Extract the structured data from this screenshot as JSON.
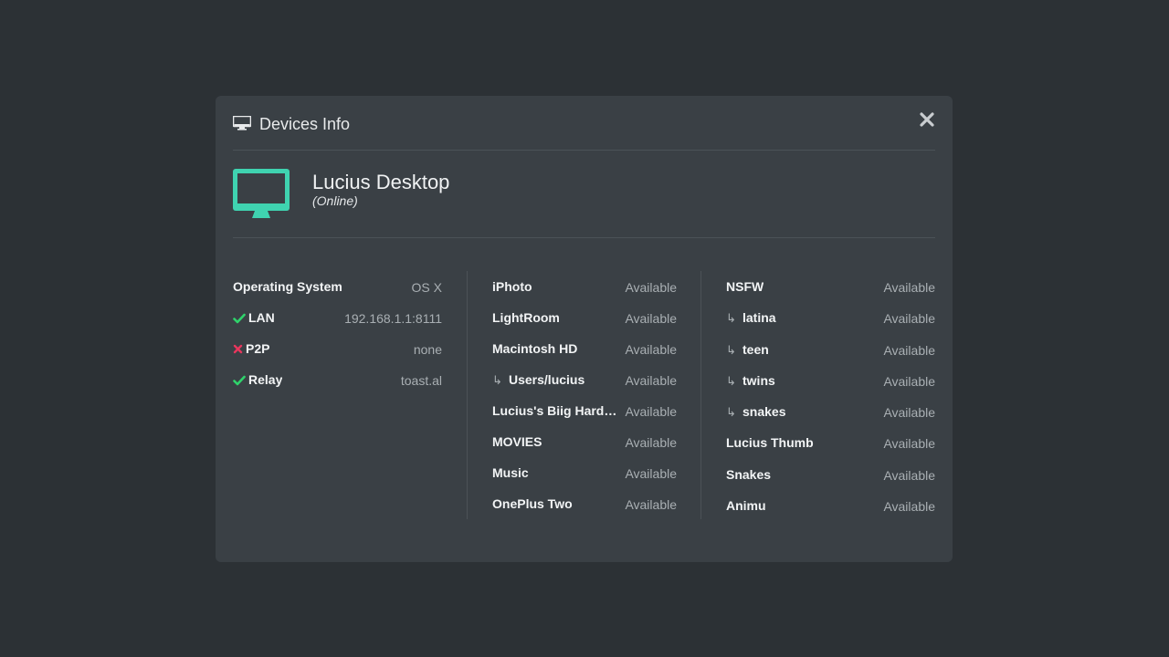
{
  "modal": {
    "title": "Devices Info"
  },
  "device": {
    "name": "Lucius Desktop",
    "status": "(Online)"
  },
  "colors": {
    "accent": "#3fd3b0",
    "ok": "#2fd36b",
    "error": "#e8365d"
  },
  "system": [
    {
      "label": "Operating System",
      "value": "OS X",
      "icon": ""
    },
    {
      "label": "LAN",
      "value": "192.168.1.1:8111",
      "icon": "check-icon"
    },
    {
      "label": "P2P",
      "value": "none",
      "icon": "cross-icon"
    },
    {
      "label": "Relay",
      "value": "toast.al",
      "icon": "check-icon"
    }
  ],
  "folders_left": [
    {
      "label": "iPhoto",
      "value": "Available",
      "sub": false
    },
    {
      "label": "LightRoom",
      "value": "Available",
      "sub": false
    },
    {
      "label": "Macintosh HD",
      "value": "Available",
      "sub": false
    },
    {
      "label": "Users/lucius",
      "value": "Available",
      "sub": true
    },
    {
      "label": "Lucius's Biig Hard…",
      "value": "Available",
      "sub": false
    },
    {
      "label": "MOVIES",
      "value": "Available",
      "sub": false
    },
    {
      "label": "Music",
      "value": "Available",
      "sub": false
    },
    {
      "label": "OnePlus Two",
      "value": "Available",
      "sub": false
    }
  ],
  "folders_right": [
    {
      "label": "NSFW",
      "value": "Available",
      "sub": false
    },
    {
      "label": "latina",
      "value": "Available",
      "sub": true
    },
    {
      "label": "teen",
      "value": "Available",
      "sub": true
    },
    {
      "label": "twins",
      "value": "Available",
      "sub": true
    },
    {
      "label": "snakes",
      "value": "Available",
      "sub": true
    },
    {
      "label": "Lucius Thumb",
      "value": "Available",
      "sub": false
    },
    {
      "label": "Snakes",
      "value": "Available",
      "sub": false
    },
    {
      "label": "Animu",
      "value": "Available",
      "sub": false
    }
  ],
  "sub_arrow": "↳"
}
